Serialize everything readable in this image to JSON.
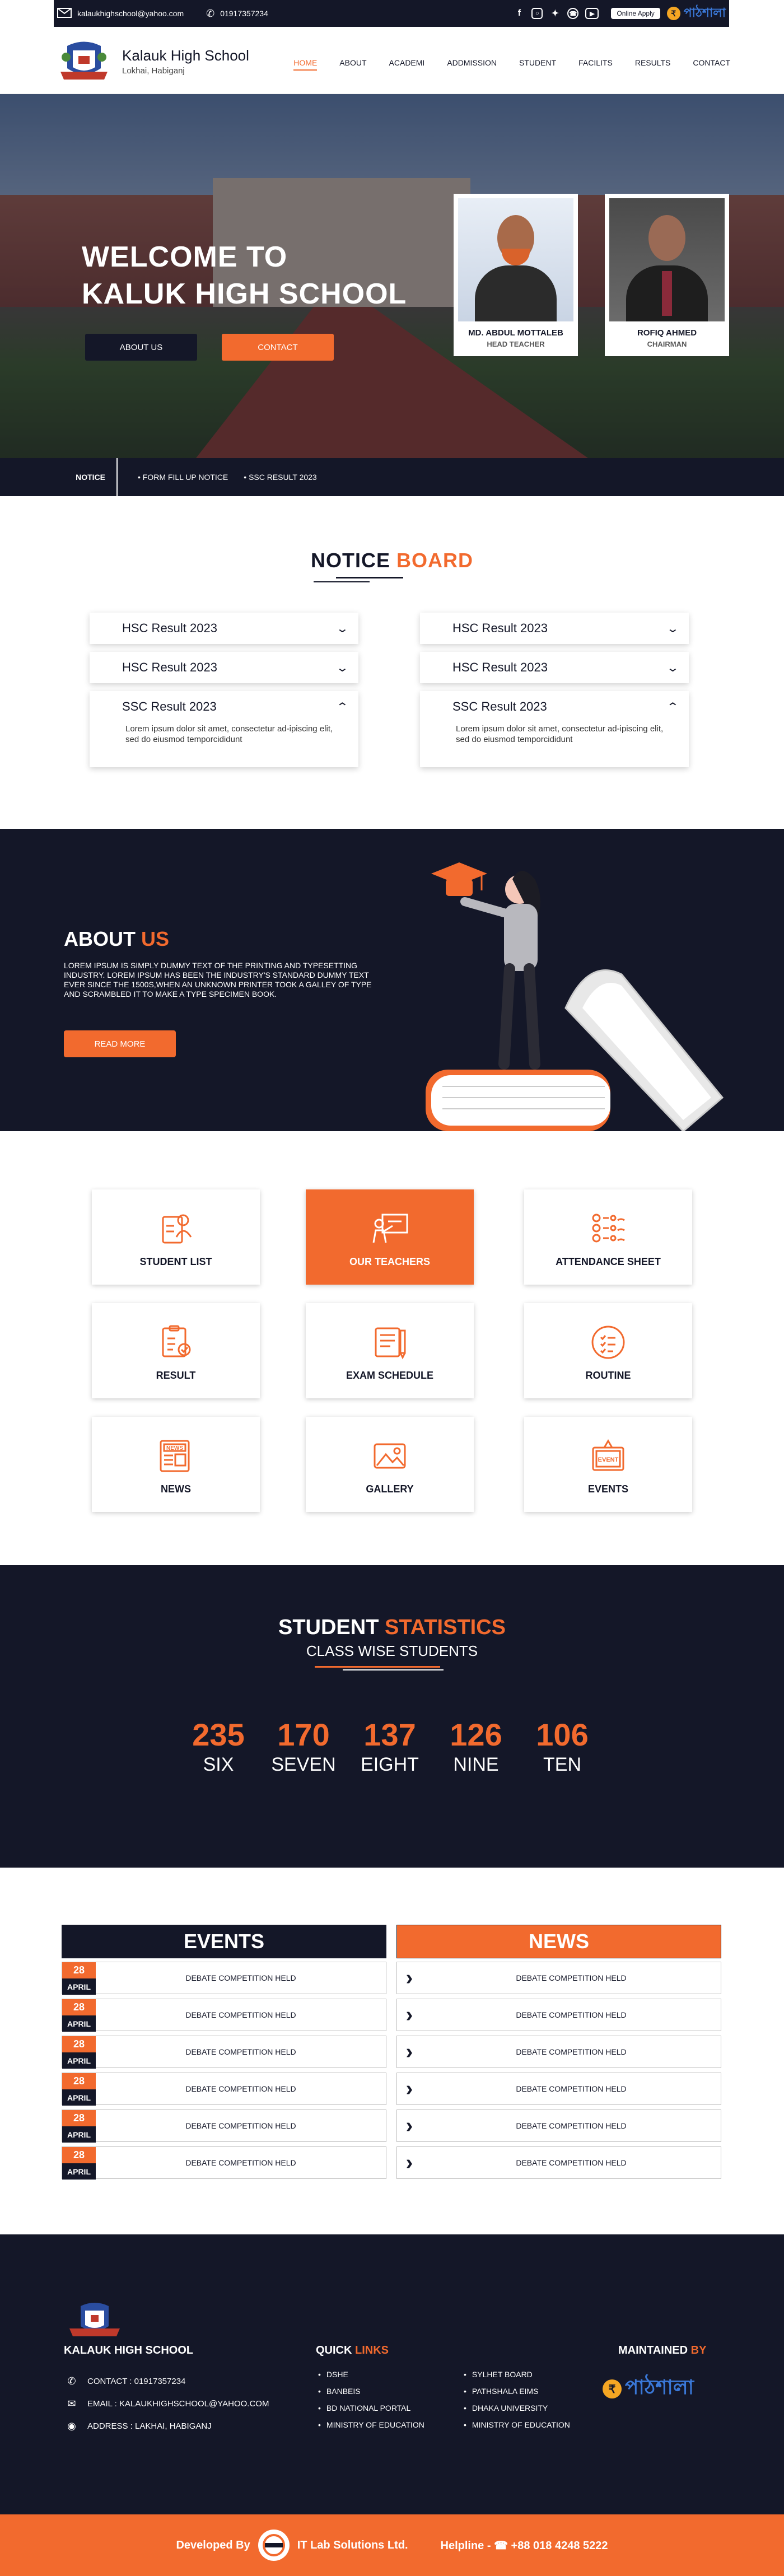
{
  "topbar": {
    "email": "kalaukhighschool@yahoo.com",
    "phone": "01917357234",
    "apply_label": "Online Apply",
    "brand": "পাঠশালা",
    "social_icons": [
      "facebook-icon",
      "instagram-icon",
      "twitter-icon",
      "whatsapp-icon",
      "youtube-icon"
    ]
  },
  "header": {
    "school_name": "Kalauk High School",
    "location": "Lokhai, Habiganj",
    "nav": [
      "HOME",
      "ABOUT",
      "ACADEMI",
      "ADDMISSION",
      "STUDENT",
      "FACILITS",
      "RESULTS",
      "CONTACT"
    ],
    "active_nav": "HOME"
  },
  "hero": {
    "welcome_line1": "WELCOME TO",
    "welcome_line2": "KALUK HIGH SCHOOL",
    "about_btn": "ABOUT US",
    "contact_btn": "CONTACT",
    "people": [
      {
        "name": "MD. ABDUL MOTTALEB",
        "role": "HEAD TEACHER"
      },
      {
        "name": "ROFIQ AHMED",
        "role": "CHAIRMAN"
      }
    ]
  },
  "notice_bar": {
    "label": "NOTICE",
    "items": [
      "FORM FILL UP NOTICE",
      "SSC RESULT 2023"
    ]
  },
  "notice_board": {
    "title_a": "NOTICE",
    "title_b": "BOARD",
    "left": [
      {
        "title": "HSC Result 2023",
        "open": false
      },
      {
        "title": "HSC Result 2023",
        "open": false
      },
      {
        "title": "SSC Result 2023",
        "open": true,
        "body": "Lorem ipsum dolor sit amet, consectetur ad-ipiscing elit, sed do eiusmod temporcididunt"
      }
    ],
    "right": [
      {
        "title": "HSC Result 2023",
        "open": false
      },
      {
        "title": "HSC Result 2023",
        "open": false
      },
      {
        "title": "SSC Result 2023",
        "open": true,
        "body": "Lorem ipsum dolor sit amet, consectetur ad-ipiscing elit, sed do eiusmod temporcididunt"
      }
    ]
  },
  "about": {
    "title_a": "ABOUT",
    "title_b": "US",
    "text": "Lorem Ipsum is simply dummy text of the printing and typesetting industry. Lorem Ipsum has been the industry's standard dummy text ever since the 1500s,when an unknown printer took a galley of type and scrambled it to make a type specimen book.",
    "button": "READ MORE"
  },
  "features": [
    {
      "label": "STUDENT LIST",
      "icon": "student-list-icon"
    },
    {
      "label": "OUR TEACHERS",
      "icon": "teacher-icon",
      "active": true
    },
    {
      "label": "ATTENDANCE SHEET",
      "icon": "attendance-icon"
    },
    {
      "label": "RESULT",
      "icon": "result-icon"
    },
    {
      "label": "EXAM SCHEDULE",
      "icon": "exam-schedule-icon"
    },
    {
      "label": "ROUTINE",
      "icon": "routine-icon"
    },
    {
      "label": "NEWS",
      "icon": "news-icon"
    },
    {
      "label": "GALLERY",
      "icon": "gallery-icon"
    },
    {
      "label": "EVENTS",
      "icon": "event-icon"
    }
  ],
  "statistics": {
    "title_a": "STUDENT",
    "title_b": "STATISTICS",
    "subtitle": "CLASS WISE STUDENTS",
    "items": [
      {
        "count": "235",
        "class": "SIX"
      },
      {
        "count": "170",
        "class": "SEVEN"
      },
      {
        "count": "137",
        "class": "EIGHT"
      },
      {
        "count": "126",
        "class": "NINE"
      },
      {
        "count": "106",
        "class": "TEN"
      }
    ]
  },
  "events": {
    "title": "EVENTS",
    "items": [
      {
        "day": "28",
        "month": "APRIL",
        "text": "DEBATE COMPETITION HELD"
      },
      {
        "day": "28",
        "month": "APRIL",
        "text": "DEBATE COMPETITION HELD"
      },
      {
        "day": "28",
        "month": "APRIL",
        "text": "DEBATE COMPETITION HELD"
      },
      {
        "day": "28",
        "month": "APRIL",
        "text": "DEBATE COMPETITION HELD"
      },
      {
        "day": "28",
        "month": "APRIL",
        "text": "DEBATE COMPETITION HELD"
      },
      {
        "day": "28",
        "month": "APRIL",
        "text": "DEBATE COMPETITION HELD"
      }
    ]
  },
  "news": {
    "title": "NEWS",
    "items": [
      "DEBATE COMPETITION HELD",
      "DEBATE COMPETITION HELD",
      "DEBATE COMPETITION HELD",
      "DEBATE COMPETITION HELD",
      "DEBATE COMPETITION HELD",
      "DEBATE COMPETITION HELD"
    ]
  },
  "footer": {
    "school": "KALAUK HIGH SCHOOL",
    "contact": "CONTACT : 01917357234",
    "email": "EMAIL : KALAUKHIGHSCHOOL@YAHOO.COM",
    "address": "ADDRESS : LAKHAI, HABIGANJ",
    "quick_a": "QUICK",
    "quick_b": "LINKS",
    "links_col1": [
      "DSHE",
      "BANBEIS",
      "BD NATIONAL PORTAL",
      "MINISTRY OF EDUCATION"
    ],
    "links_col2": [
      "SYLHET BOARD",
      "PATHSHALA EIMS",
      "DHAKA UNIVERSITY",
      "MINISTRY OF EDUCATION"
    ],
    "maintained_a": "MAINTAINED",
    "maintained_b": "BY",
    "maintainer": "পাঠশালা"
  },
  "bottom_bar": {
    "developed_by": "Developed By",
    "company": "IT Lab Solutions Ltd.",
    "helpline": "Helpline - ☎ +88 018 4248 5222"
  },
  "colors": {
    "navy": "#141728",
    "accent": "#f26a2e"
  }
}
